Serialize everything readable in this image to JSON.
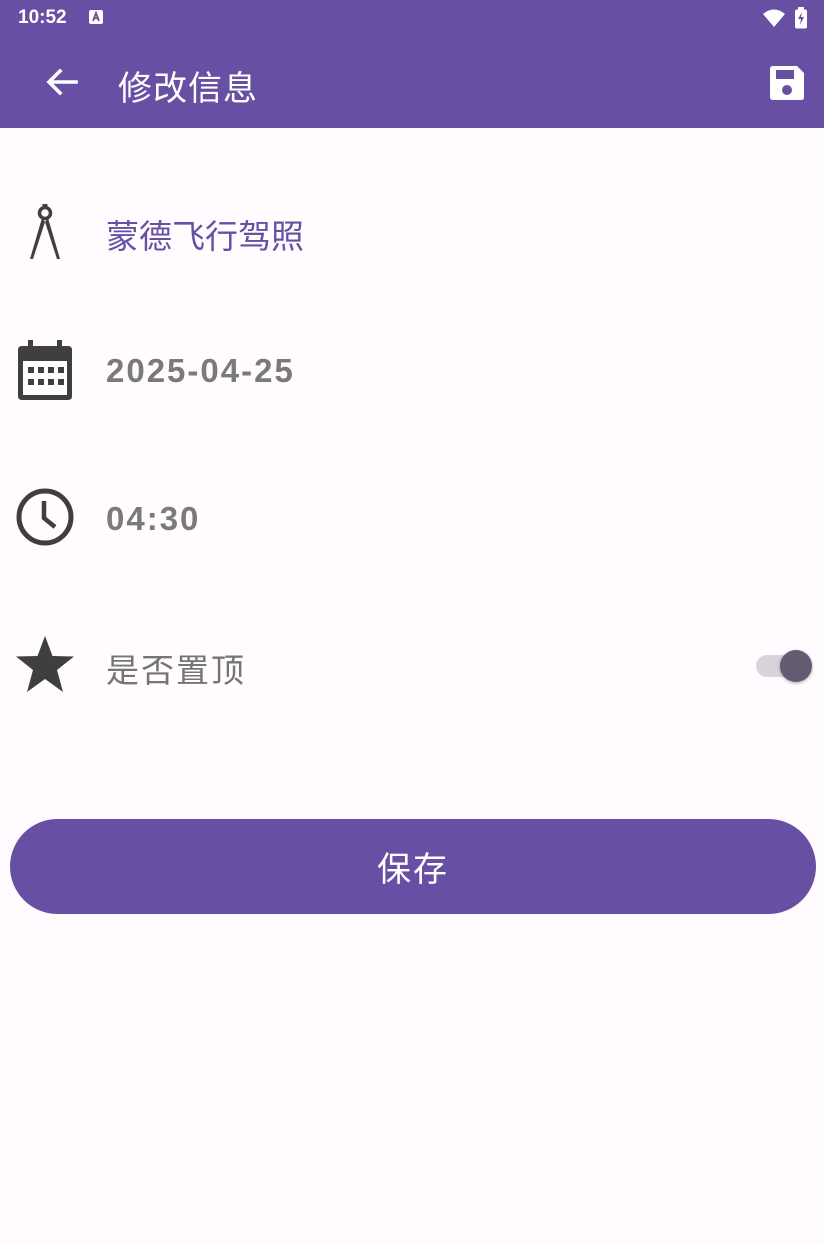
{
  "status_bar": {
    "time": "10:52",
    "icons": [
      "notification-a-icon",
      "wifi-icon",
      "battery-charging-icon"
    ]
  },
  "app_bar": {
    "title": "修改信息",
    "back_icon": "arrow-back-icon",
    "save_icon": "floppy-disk-icon",
    "color": "#6750a4"
  },
  "form": {
    "name": {
      "icon": "compass-icon",
      "value": "蒙德飞行驾照",
      "color": "#6750a4"
    },
    "date": {
      "icon": "calendar-icon",
      "value": "2025-04-25"
    },
    "time": {
      "icon": "clock-icon",
      "value": "04:30"
    },
    "pin": {
      "icon": "star-icon",
      "label": "是否置顶",
      "toggle_on": true
    }
  },
  "save_button": {
    "label": "保存"
  },
  "colors": {
    "primary": "#6750a4",
    "background": "#fffbfe",
    "icon": "#3f3f3f",
    "muted_text": "#7a7a7a"
  }
}
